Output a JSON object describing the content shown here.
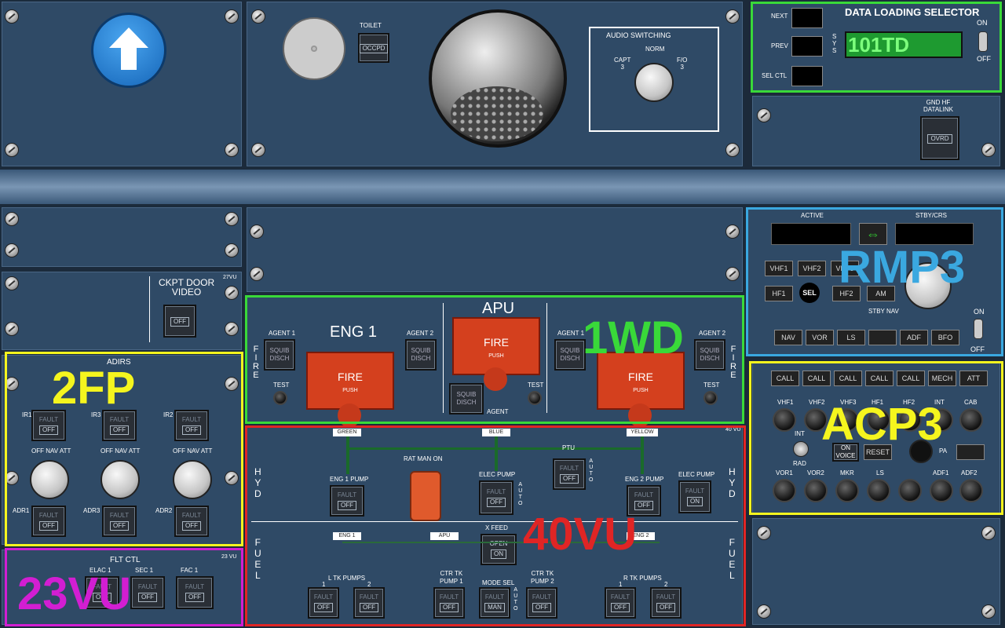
{
  "panels": {
    "top_center": {
      "toilet": "TOILET",
      "occpd": "OCCPD",
      "audio_title": "AUDIO SWITCHING",
      "audio_norm": "NORM",
      "audio_capt": "CAPT\n3",
      "audio_fo": "F/O\n3"
    },
    "dls": {
      "title": "DATA LOADING SELECTOR",
      "next": "NEXT",
      "prev": "PREV",
      "sel_ctl": "SEL CTL",
      "sys": "S\nY\nS",
      "display": "101TD",
      "on": "ON",
      "off": "OFF",
      "ring": "ring-icon"
    },
    "gnd_hf": {
      "title": "GND HF\nDATALINK",
      "ovrd": "OVRD"
    },
    "ckpt": {
      "title": "CKPT DOOR\nVIDEO",
      "vu": "27VU",
      "off": "OFF"
    },
    "adirs": {
      "title": "ADIRS",
      "ir1": "IR1",
      "ir3": "IR3",
      "ir2": "IR2",
      "fault": "FAULT",
      "off": "OFF",
      "mode_off": "OFF",
      "mode_nav": "NAV",
      "mode_att": "ATT",
      "adr1": "ADR1",
      "adr3": "ADR3",
      "adr2": "ADR2",
      "tag": "2FP"
    },
    "fltctl": {
      "title": "FLT CTL",
      "vu": "23 VU",
      "elac": "ELAC 1",
      "sec": "SEC 1",
      "fac": "FAC 1",
      "fault": "FAULT",
      "off": "OFF",
      "tag": "23VU"
    },
    "fire": {
      "eng1": "ENG 1",
      "apu": "APU",
      "agent1": "AGENT 1",
      "agent2": "AGENT 2",
      "squib": "SQUIB",
      "disch": "DISCH",
      "test": "TEST",
      "fire": "FIRE",
      "push": "PUSH",
      "agent": "AGENT",
      "side": "F\nI\nR\nE",
      "tag": "1WD"
    },
    "hyd": {
      "green": "GREEN",
      "blue": "BLUE",
      "yellow": "YELLOW",
      "rat": "RAT MAN ON",
      "ptu": "PTU",
      "eng1pump": "ENG 1 PUMP",
      "elecpump": "ELEC PUMP",
      "eng2pump": "ENG 2 PUMP",
      "elecpump2": "ELEC PUMP",
      "fault": "FAULT",
      "off": "OFF",
      "on": "ON",
      "auto": "A\nU\nT\nO",
      "hyd": "H\nY\nD",
      "fuel": "F\nU\nE\nL",
      "vu": "40 VU",
      "tag": "40VU"
    },
    "fuel": {
      "eng1": "ENG 1",
      "apu": "APU",
      "eng2": "ENG 2",
      "xfeed": "X FEED",
      "open": "OPEN",
      "on": "ON",
      "ltk": "L TK PUMPS",
      "rtk": "R TK PUMPS",
      "ctr1": "CTR TK\nPUMP 1",
      "mode": "MODE SEL",
      "ctr2": "CTR TK\nPUMP 2",
      "man": "MAN",
      "one": "1",
      "two": "2"
    },
    "rmp": {
      "active": "ACTIVE",
      "stby": "STBY/CRS",
      "vhf1": "VHF1",
      "vhf2": "VHF2",
      "vhf3": "VHF3",
      "hf1": "HF1",
      "sel": "SEL",
      "hf2": "HF2",
      "am": "AM",
      "stbynav": "STBY NAV",
      "nav": "NAV",
      "vor": "VOR",
      "ls": "LS",
      "adf": "ADF",
      "bfo": "BFO",
      "on": "ON",
      "off": "OFF",
      "tag": "RMP3"
    },
    "acp": {
      "call": "CALL",
      "mech": "MECH",
      "att": "ATT",
      "vhf1": "VHF1",
      "vhf2": "VHF2",
      "vhf3": "VHF3",
      "hf1": "HF1",
      "hf2": "HF2",
      "int": "INT",
      "cab": "CAB",
      "rad": "RAD",
      "intl": "INT",
      "on": "ON",
      "voice": "VOICE",
      "reset": "RESET",
      "pa": "PA",
      "vor1": "VOR1",
      "vor2": "VOR2",
      "mkr": "MKR",
      "ls": "LS",
      "adf1": "ADF1",
      "adf2": "ADF2",
      "tag": "ACP3"
    }
  },
  "colors": {
    "panel": "#2f4a66",
    "green_hl": "#39d939",
    "yellow_hl": "#f5f51e",
    "cyan_hl": "#3aa8e0",
    "red_hl": "#e02525",
    "magenta_hl": "#d21ed2"
  }
}
